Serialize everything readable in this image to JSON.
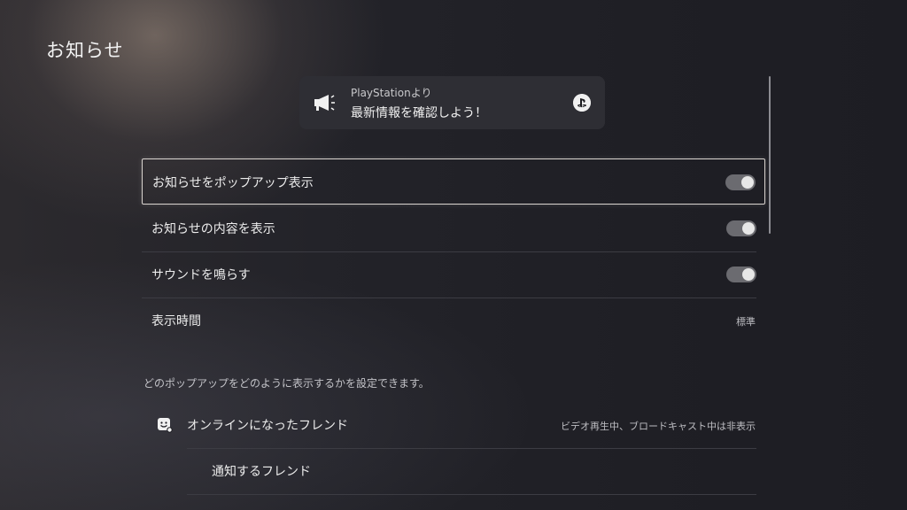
{
  "page": {
    "title": "お知らせ"
  },
  "preview": {
    "from": "PlayStationより",
    "message": "最新情報を確認しよう！",
    "icons": [
      "megaphone-icon",
      "playstation-logo-icon"
    ]
  },
  "settings": [
    {
      "label": "お知らせをポップアップ表示",
      "type": "toggle",
      "on": true,
      "focused": true
    },
    {
      "label": "お知らせの内容を表示",
      "type": "toggle",
      "on": true
    },
    {
      "label": "サウンドを鳴らす",
      "type": "toggle",
      "on": true
    },
    {
      "label": "表示時間",
      "type": "value",
      "value": "標準"
    }
  ],
  "hint": "どのポップアップをどのように表示するかを設定できます。",
  "popup_types": {
    "online_friends": {
      "label": "オンラインになったフレンド",
      "value": "ビデオ再生中、ブロードキャスト中は非表示",
      "icon": "friend-icon"
    },
    "notify_friends": {
      "label": "通知するフレンド"
    }
  },
  "colors": {
    "focus_border": "#d9d4cf",
    "toggle_track": "#6b6b70",
    "toggle_knob": "#e7e7e7"
  }
}
